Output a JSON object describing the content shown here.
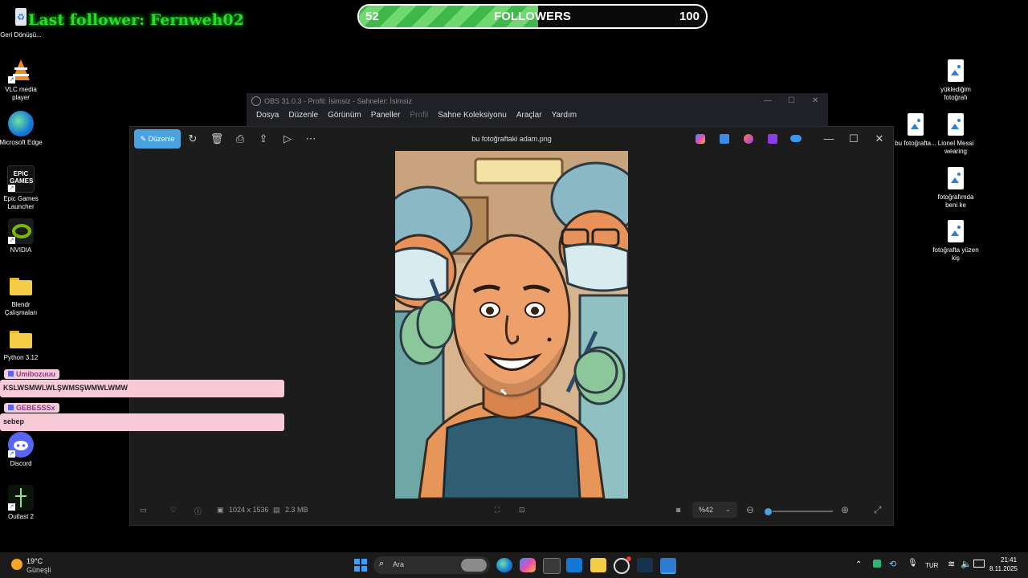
{
  "desktop": {
    "left_icons": [
      "Geri Dönüşü...",
      "VLC media player",
      "Microsoft Edge",
      "Epic Games Launcher",
      "NVIDIA",
      "Blendr Çalışmaları",
      "Python 3.12",
      "Discord",
      "Outlast 2"
    ],
    "right_icons": [
      "yüklediğim fotoğrafı",
      "bu fotoğrafta...",
      "Lionel Messi wearing",
      "fotoğrafımda beni ke",
      "fotoğrafta yüzen kiş"
    ],
    "epic_logo": "EPIC GAMES"
  },
  "overlay": {
    "last_follower": "Last follower: Fernweh02",
    "followers_current": "52",
    "followers_label": "FOLLOWERS",
    "followers_goal": "100",
    "followers_progress": 0.52,
    "chat": [
      {
        "user": "Umibozuuu",
        "message": "KSLWSMWLWLŞWMSŞWMWLWMW"
      },
      {
        "user": "GEBESSSx",
        "message": "sebep"
      }
    ]
  },
  "obs": {
    "title": "OBS 31.0.3 - Profil: İsimsiz - Sahneler: İsimsiz",
    "menu": [
      "Dosya",
      "Düzenle",
      "Görünüm",
      "Paneller",
      "Profil",
      "Sahne Koleksiyonu",
      "Araçlar",
      "Yardım"
    ]
  },
  "photos": {
    "edit_label": "Düzenle",
    "file_name": "bu fotoğraftaki adam.png",
    "dimensions": "1024 x 1536",
    "file_size": "2.3 MB",
    "zoom": "%42",
    "zoom_level": 0.05
  },
  "taskbar": {
    "weather_temp": "19°C",
    "weather_desc": "Güneşli",
    "search_placeholder": "Ara",
    "lang": "TUR",
    "time": "21:41",
    "date": "8.11.2025"
  },
  "colors": {
    "accent": "#4aa3df",
    "progress": "#3fb84a",
    "chat_bg": "#f8cad8"
  }
}
